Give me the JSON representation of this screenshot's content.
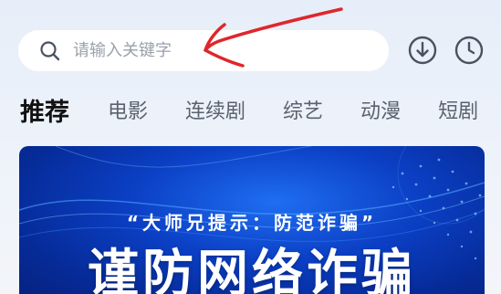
{
  "search": {
    "placeholder": "请输入关键字"
  },
  "header_icons": [
    "download-icon",
    "history-icon"
  ],
  "tabs": [
    {
      "label": "推荐",
      "active": true
    },
    {
      "label": "电影"
    },
    {
      "label": "连续剧"
    },
    {
      "label": "综艺"
    },
    {
      "label": "动漫"
    },
    {
      "label": "短剧"
    }
  ],
  "banner": {
    "subtitle": "“大师兄提示：防范诈骗”",
    "title": "谨防网络诈骗"
  },
  "colors": {
    "accent_annotation": "#e0262b",
    "banner_blue": "#0b3fc4",
    "icon_gray": "#4a5260"
  }
}
